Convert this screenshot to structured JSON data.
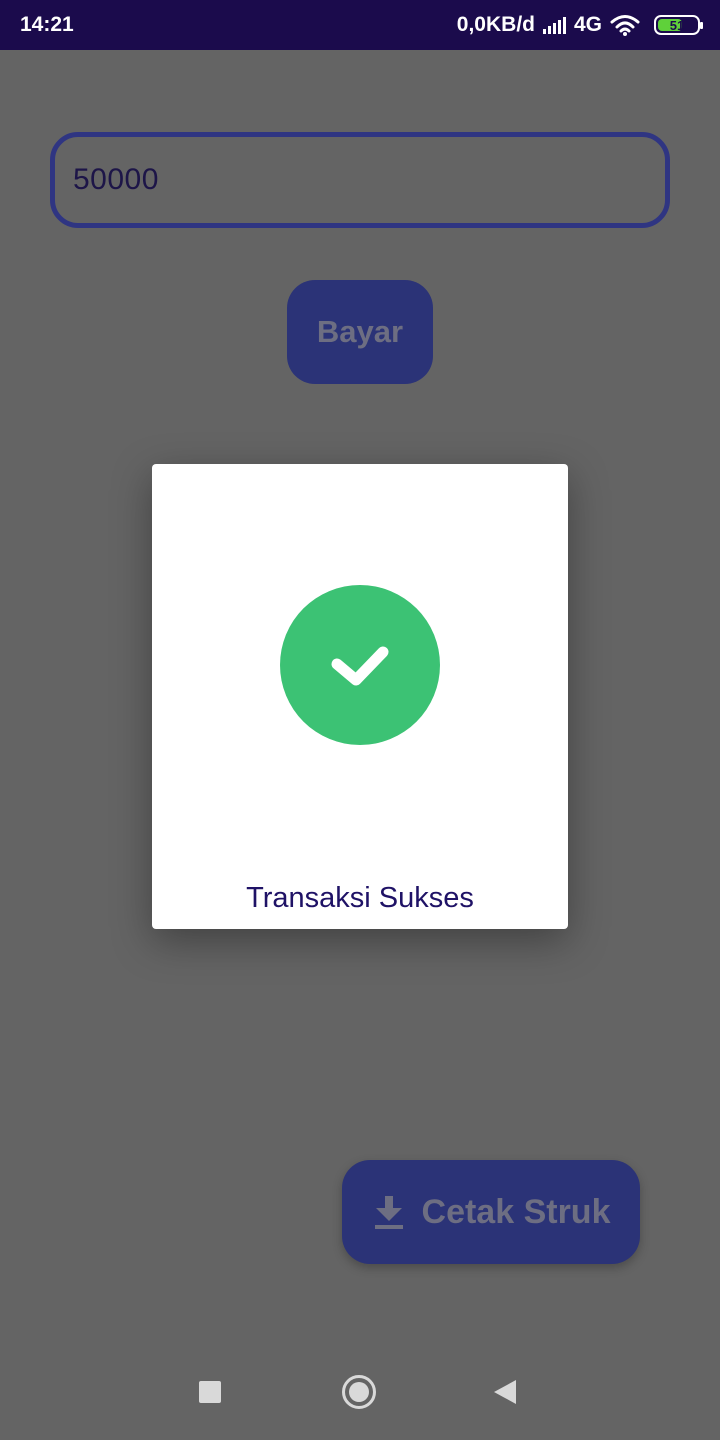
{
  "status_bar": {
    "time": "14:21",
    "data_rate": "0,0KB/d",
    "network": "4G",
    "battery_level": "51",
    "icons": [
      "signal-icon",
      "wifi-icon",
      "battery-icon"
    ]
  },
  "payment": {
    "amount_value": "50000",
    "pay_button_label": "Bayar"
  },
  "receipt": {
    "print_button_label": "Cetak Struk",
    "icon": "download-icon"
  },
  "dialog": {
    "icon": "success-check-icon",
    "message": "Transaksi Sukses"
  },
  "colors": {
    "status_bar": "#1b0b4c",
    "accent_button": "#2b3377",
    "success_green": "#3cc274",
    "dialog_text": "#1f1266",
    "overlay": "#646464"
  },
  "nav_bar": {
    "icons": [
      "recent-apps-icon",
      "home-icon",
      "back-icon"
    ]
  }
}
